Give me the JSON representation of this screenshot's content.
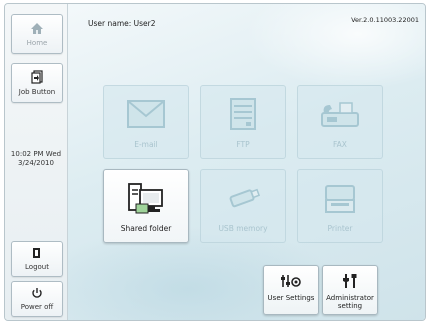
{
  "sidebar": {
    "home_label": "Home",
    "job_button_label": "Job Button",
    "clock_time": "10:02 PM  Wed",
    "clock_date": "3/24/2010",
    "logout_label": "Logout",
    "power_off_label": "Power off"
  },
  "header": {
    "user_name": "User name: User2",
    "version": "Ver.2.0.11003.22001"
  },
  "tiles": {
    "email": {
      "label": "E-mail",
      "enabled": false,
      "icon": "envelope-icon"
    },
    "ftp": {
      "label": "FTP",
      "enabled": false,
      "icon": "server-icon"
    },
    "fax": {
      "label": "FAX",
      "enabled": false,
      "icon": "fax-icon"
    },
    "shared_folder": {
      "label": "Shared folder",
      "enabled": true,
      "icon": "shared-folder-icon"
    },
    "usb_memory": {
      "label": "USB memory",
      "enabled": false,
      "icon": "usb-icon"
    },
    "printer": {
      "label": "Printer",
      "enabled": false,
      "icon": "printer-icon"
    }
  },
  "bottom_buttons": {
    "user_settings": "User Settings",
    "administrator_setting_line1": "Administrator",
    "administrator_setting_line2": "setting"
  },
  "colors": {
    "disabled_tile_text": "#a9c4ce",
    "background": "#dcecf1"
  }
}
